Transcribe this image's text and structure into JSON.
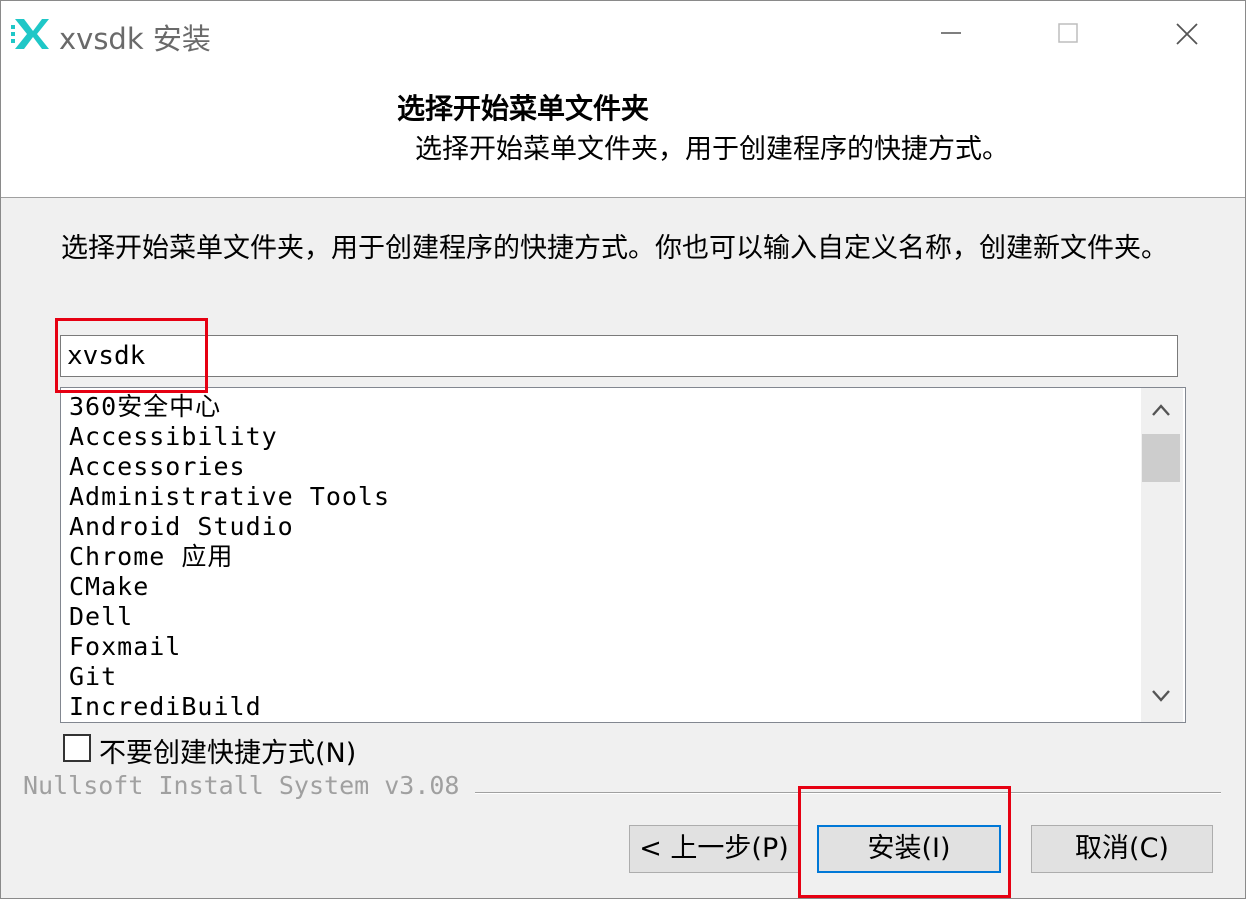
{
  "window": {
    "title": "xvsdk 安装"
  },
  "header": {
    "title": "选择开始菜单文件夹",
    "subtitle": "选择开始菜单文件夹，用于创建程序的快捷方式。"
  },
  "main": {
    "intro": "选择开始菜单文件夹，用于创建程序的快捷方式。你也可以输入自定义名称，创建新文件夹。",
    "folder_input_value": "xvsdk",
    "folder_list": [
      "360安全中心",
      "Accessibility",
      "Accessories",
      "Administrative Tools",
      "Android Studio",
      "Chrome 应用",
      "CMake",
      "Dell",
      "Foxmail",
      "Git",
      "IncrediBuild"
    ],
    "no_shortcut_label": "不要创建快捷方式(N)",
    "no_shortcut_checked": false
  },
  "footer": {
    "brand": "Nullsoft Install System v3.08",
    "back_label": "< 上一步(P)",
    "install_label": "安装(I)",
    "cancel_label": "取消(C)"
  },
  "colors": {
    "annotation": "#e60012",
    "accent": "#0078d7",
    "logo": "#1fc7c7"
  },
  "icons": {
    "app": "xvsdk-logo-icon",
    "minimize": "minimize-icon",
    "maximize": "maximize-icon",
    "close": "close-icon",
    "scroll_up": "chevron-up-icon",
    "scroll_down": "chevron-down-icon"
  }
}
